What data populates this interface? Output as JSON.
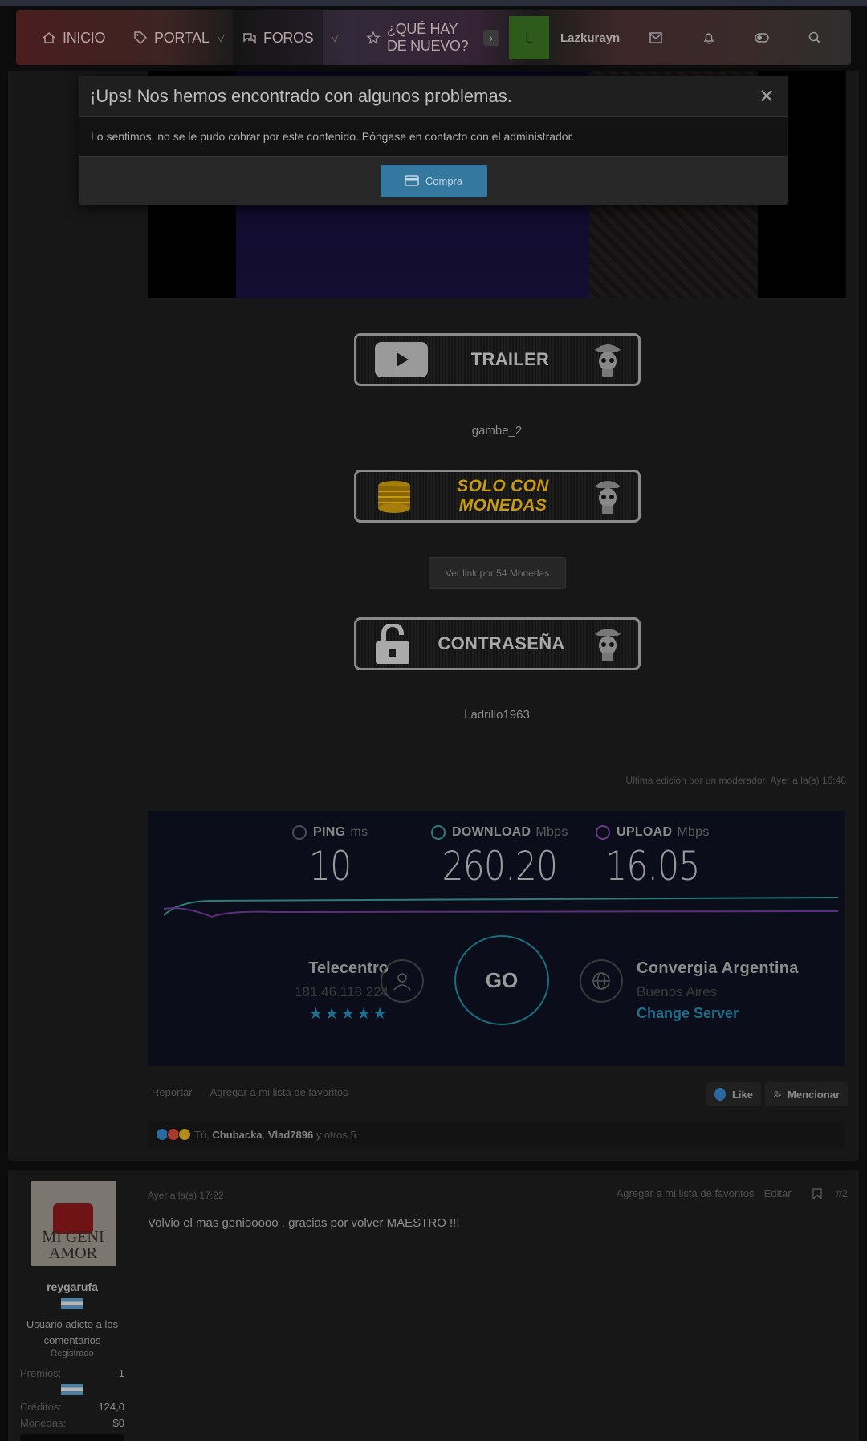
{
  "nav": {
    "home": "INICIO",
    "portal": "PORTAL",
    "forums": "FOROS",
    "whats_new": "¿QUÉ HAY DE NUEVO?",
    "avatar_letter": "L",
    "username": "Lazkurayn"
  },
  "modal": {
    "title": "¡Ups! Nos hemos encontrado con algunos problemas.",
    "message": "Lo sentimos, no se le pudo cobrar por este contenido. Póngase en contacto con el administrador.",
    "button": "Compra",
    "close": "✕"
  },
  "post": {
    "trailer_label": "TRAILER",
    "trailer_text": "gambe_2",
    "coins_label": "SOLO CON MONEDAS",
    "link_button": "Ver link por 54 Monedas",
    "password_label": "CONTRASEÑA",
    "password_value": "Ladrillo1963",
    "edit_note": "Última edición por un moderador: Ayer a la(s) 16:48"
  },
  "speedtest": {
    "ping_label": "PING",
    "ping_unit": "ms",
    "ping_value": "10",
    "download_label": "DOWNLOAD",
    "download_unit": "Mbps",
    "download_value": "260.20",
    "upload_label": "UPLOAD",
    "upload_unit": "Mbps",
    "upload_value": "16.05",
    "isp_name": "Telecentro",
    "isp_ip": "181.46.118.224",
    "stars": "★★★★★",
    "go": "GO",
    "server_name": "Convergia Argentina",
    "server_city": "Buenos Aires",
    "change_server": "Change Server"
  },
  "post_actions": {
    "report": "Reportar",
    "bookmark": "Agregar a mi lista de favoritos",
    "like": "Like",
    "mention": "Mencionar"
  },
  "reactions": {
    "prefix": "Tú,",
    "user1": "Chubacka",
    "sep": ",",
    "user2": "Vlad7896",
    "suffix": "y otros 5"
  },
  "post2": {
    "avatar_text": "MI GENI AMOR",
    "username": "reygarufa",
    "user_title": "Usuario adicto a los comentarios",
    "role": "Registrado",
    "stats": [
      {
        "label": "Premios:",
        "value": "1"
      },
      {
        "label": "Créditos:",
        "value": "124,0"
      },
      {
        "label": "Monedas:",
        "value": "$0"
      }
    ],
    "date": "Ayer a la(s) 17:22",
    "bookmark": "Agregar a mi lista de favoritos",
    "edit": "Editar",
    "number": "#2",
    "body": "Volvio el mas geniooooo . gracias por volver MAESTRO !!!"
  },
  "colors": {
    "accent_blue": "#3478a0",
    "speed_teal": "#18707e",
    "download_line": "#2a7d7a",
    "upload_line": "#5a2f7a"
  }
}
